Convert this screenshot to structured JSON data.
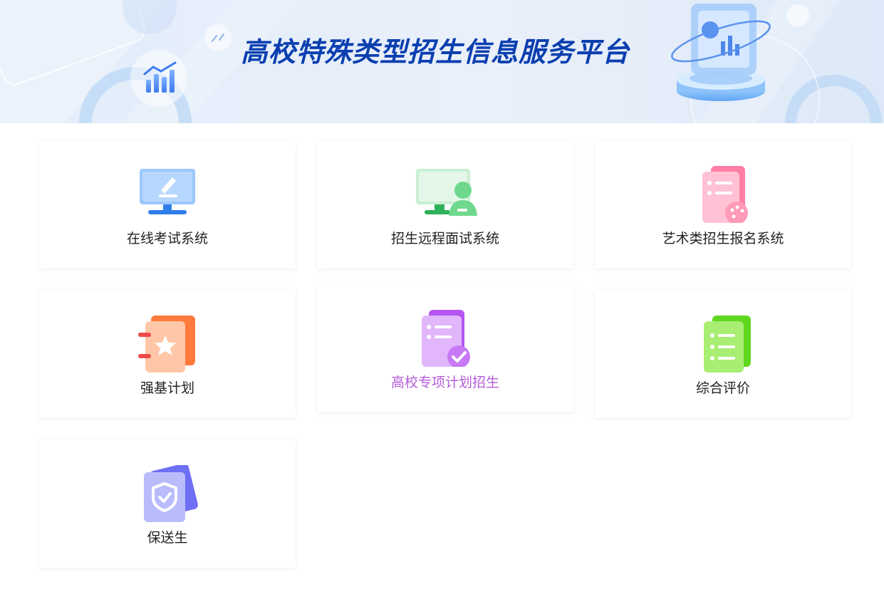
{
  "banner": {
    "title": "高校特殊类型招生信息服务平台"
  },
  "colors": {
    "title": "#0b3fb0",
    "active_label": "#b35bd8",
    "label": "#222222"
  },
  "cards": [
    {
      "label": "在线考试系统",
      "icon": "monitor-pen-icon"
    },
    {
      "label": "招生远程面试系统",
      "icon": "monitor-person-icon"
    },
    {
      "label": "艺术类招生报名系统",
      "icon": "list-palette-icon"
    },
    {
      "label": "强基计划",
      "icon": "notebook-star-icon"
    },
    {
      "label": "高校专项计划招生",
      "icon": "list-check-icon"
    },
    {
      "label": "综合评价",
      "icon": "list-icon"
    },
    {
      "label": "保送生",
      "icon": "shield-check-icon"
    }
  ]
}
